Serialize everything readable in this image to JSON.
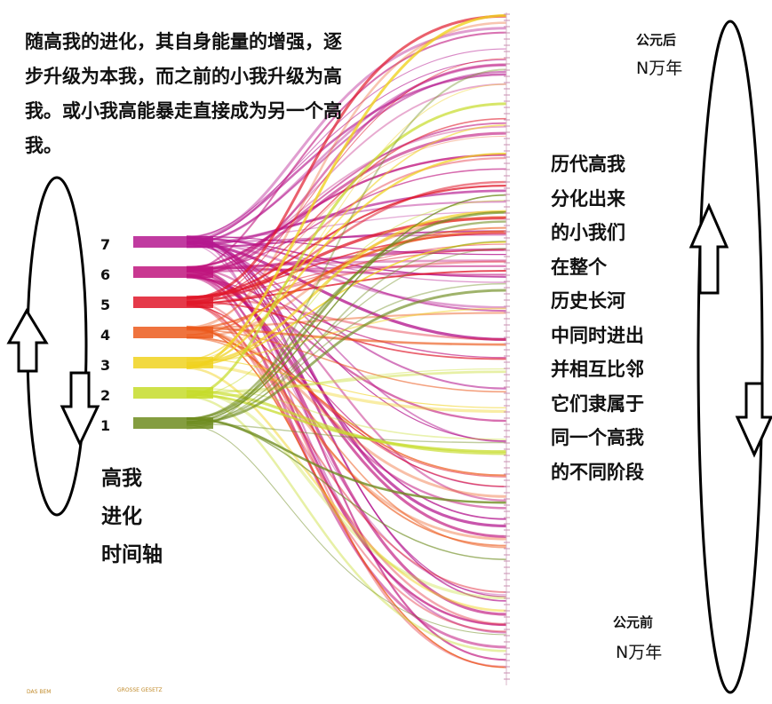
{
  "intro_text": "随高我的进化，其自身能量的增强，逐步升级为本我，而之前的小我升级为高我。或小我高能暴走直接成为另一个高我。",
  "axis_label_lines": [
    "高我",
    "进化",
    "时间轴"
  ],
  "right_text_lines": [
    "历代高我",
    "分化出来",
    "的小我们",
    "在整个",
    "历史长河",
    "中同时进出",
    "并相互比邻",
    "它们隶属于",
    "同一个高我",
    "的不同阶段"
  ],
  "time_top": {
    "line1": "公元后",
    "line2": "N万年"
  },
  "time_bottom": {
    "line1": "公元前",
    "line2": "N万年"
  },
  "levels": [
    {
      "label": "7",
      "color": "#b5198f"
    },
    {
      "label": "6",
      "color": "#c0157e"
    },
    {
      "label": "5",
      "color": "#e0182a"
    },
    {
      "label": "4",
      "color": "#ec5a1c"
    },
    {
      "label": "3",
      "color": "#f0d21e"
    },
    {
      "label": "2",
      "color": "#c6dc2a"
    },
    {
      "label": "1",
      "color": "#6e8c1e"
    }
  ],
  "tiny_labels": [
    "DAS BEM",
    "GROSSE GESETZ"
  ]
}
